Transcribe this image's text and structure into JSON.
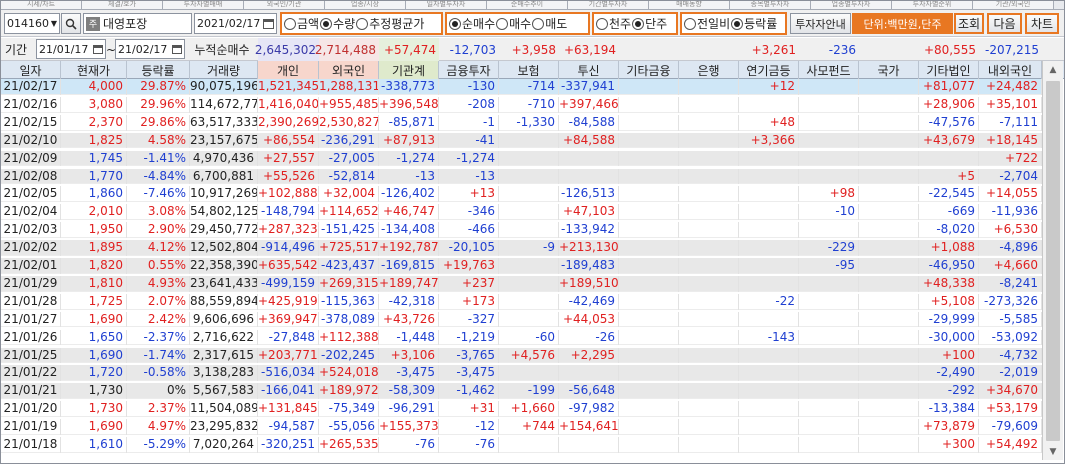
{
  "tabstrip": {
    "tabs": [
      "시세/차트",
      "체결/호가",
      "투자자별매매",
      "외국인/기관",
      "업종/시장",
      "일자별투자자",
      "순매수추이",
      "기간별투자자",
      "매매동향",
      "종목별투자자",
      "업종별투자자",
      "투자자별순위",
      "기관/외국인"
    ]
  },
  "toolbar": {
    "code": "014160",
    "name": "대영포장",
    "date": "2021/02/17",
    "group1": [
      {
        "label": "금액",
        "on": false
      },
      {
        "label": "수량",
        "on": true
      },
      {
        "label": "추정평균가",
        "on": false
      }
    ],
    "group2": [
      {
        "label": "순매수",
        "on": true
      },
      {
        "label": "매수",
        "on": false
      },
      {
        "label": "매도",
        "on": false
      }
    ],
    "group3": [
      {
        "label": "천주",
        "on": false
      },
      {
        "label": "단주",
        "on": true
      }
    ],
    "group4": [
      {
        "label": "전일비",
        "on": false
      },
      {
        "label": "등락률",
        "on": true
      }
    ],
    "guide_label": "투자자안내",
    "unit_text": "단위:백만원,단주",
    "query_label": "조회",
    "next_label": "다음",
    "chart_label": "차트"
  },
  "filter": {
    "period_label": "기간",
    "from": "21/01/17",
    "to": "21/02/17",
    "cum_label": "누적순매수",
    "values": [
      "2,645,302",
      "2,714,488",
      "+57,474",
      "-12,703",
      "+3,958",
      "+63,194",
      "",
      "",
      "+3,261",
      "-236",
      "",
      "+80,555",
      "-207,215"
    ]
  },
  "columns": [
    "일자",
    "현재가",
    "등락률",
    "거래량",
    "개인",
    "외국인",
    "기관계",
    "금융투자",
    "보험",
    "투신",
    "기타금융",
    "은행",
    "연기금등",
    "사모펀드",
    "국가",
    "기타법인",
    "내외국인"
  ],
  "colors": {
    "up": "#e02020",
    "down": "#1f3fd1",
    "selected_row": "#cfe7f7",
    "alt_row": "#e8e8e8",
    "accent": "#e87722",
    "header_personal": "#f7d6cc",
    "header_foreign": "#f7d6cc",
    "header_inst": "#dfeacc"
  },
  "rows": [
    [
      "21/02/17",
      "4,000",
      "29.87%",
      "90,075,196",
      "1,521,345",
      "1,288,131",
      "-338,773",
      "-130",
      "-714",
      "-337,941",
      "",
      "",
      "+12",
      "",
      "",
      "+81,077",
      "+24,482"
    ],
    [
      "21/02/16",
      "3,080",
      "29.96%",
      "114,672,772",
      "1,416,040",
      "+955,485",
      "+396,548",
      "-208",
      "-710",
      "+397,466",
      "",
      "",
      "",
      "",
      "",
      "+28,906",
      "+35,101"
    ],
    [
      "21/02/15",
      "2,370",
      "29.86%",
      "63,517,333",
      "2,390,269",
      "2,530,827",
      "-85,871",
      "-1",
      "-1,330",
      "-84,588",
      "",
      "",
      "+48",
      "",
      "",
      "-47,576",
      "-7,111"
    ],
    [
      "21/02/10",
      "1,825",
      "4.58%",
      "23,157,675",
      "+86,554",
      "-236,291",
      "+87,913",
      "-41",
      "",
      "+84,588",
      "",
      "",
      "+3,366",
      "",
      "",
      "+43,679",
      "+18,145"
    ],
    [
      "21/02/09",
      "1,745",
      "-1.41%",
      "4,970,436",
      "+27,557",
      "-27,005",
      "-1,274",
      "-1,274",
      "",
      "",
      "",
      "",
      "",
      "",
      "",
      "",
      "+722"
    ],
    [
      "21/02/08",
      "1,770",
      "-4.84%",
      "6,700,881",
      "+55,526",
      "-52,814",
      "-13",
      "-13",
      "",
      "",
      "",
      "",
      "",
      "",
      "",
      "+5",
      "-2,704"
    ],
    [
      "21/02/05",
      "1,860",
      "-7.46%",
      "10,917,269",
      "+102,888",
      "+32,004",
      "-126,402",
      "+13",
      "",
      "-126,513",
      "",
      "",
      "",
      "+98",
      "",
      "-22,545",
      "+14,055"
    ],
    [
      "21/02/04",
      "2,010",
      "3.08%",
      "54,802,125",
      "-148,794",
      "+114,652",
      "+46,747",
      "-346",
      "",
      "+47,103",
      "",
      "",
      "",
      "-10",
      "",
      "-669",
      "-11,936"
    ],
    [
      "21/02/03",
      "1,950",
      "2.90%",
      "29,450,772",
      "+287,323",
      "-151,425",
      "-134,408",
      "-466",
      "",
      "-133,942",
      "",
      "",
      "",
      "",
      "",
      "-8,020",
      "+6,530"
    ],
    [
      "21/02/02",
      "1,895",
      "4.12%",
      "12,502,804",
      "-914,496",
      "+725,517",
      "+192,787",
      "-20,105",
      "-9",
      "+213,130",
      "",
      "",
      "",
      "-229",
      "",
      "+1,088",
      "-4,896"
    ],
    [
      "21/02/01",
      "1,820",
      "0.55%",
      "22,358,390",
      "+635,542",
      "-423,437",
      "-169,815",
      "+19,763",
      "",
      "-189,483",
      "",
      "",
      "",
      "-95",
      "",
      "-46,950",
      "+4,660"
    ],
    [
      "21/01/29",
      "1,810",
      "4.93%",
      "23,641,433",
      "-499,159",
      "+269,315",
      "+189,747",
      "+237",
      "",
      "+189,510",
      "",
      "",
      "",
      "",
      "",
      "+48,338",
      "-8,241"
    ],
    [
      "21/01/28",
      "1,725",
      "2.07%",
      "88,559,894",
      "+425,919",
      "-115,363",
      "-42,318",
      "+173",
      "",
      "-42,469",
      "",
      "",
      "-22",
      "",
      "",
      "+5,108",
      "-273,326"
    ],
    [
      "21/01/27",
      "1,690",
      "2.42%",
      "9,606,696",
      "+369,947",
      "-378,089",
      "+43,726",
      "-327",
      "",
      "+44,053",
      "",
      "",
      "",
      "",
      "",
      "-29,999",
      "-5,585"
    ],
    [
      "21/01/26",
      "1,650",
      "-2.37%",
      "2,716,622",
      "-27,848",
      "+112,388",
      "-1,448",
      "-1,219",
      "-60",
      "-26",
      "",
      "",
      "-143",
      "",
      "",
      "-30,000",
      "-53,092"
    ],
    [
      "21/01/25",
      "1,690",
      "-1.74%",
      "2,317,615",
      "+203,771",
      "-202,245",
      "+3,106",
      "-3,765",
      "+4,576",
      "+2,295",
      "",
      "",
      "",
      "",
      "",
      "+100",
      "-4,732"
    ],
    [
      "21/01/22",
      "1,720",
      "-0.58%",
      "3,138,283",
      "-516,034",
      "+524,018",
      "-3,475",
      "-3,475",
      "",
      "",
      "",
      "",
      "",
      "",
      "",
      "-2,490",
      "-2,019"
    ],
    [
      "21/01/21",
      "1,730",
      "0%",
      "5,567,583",
      "-166,041",
      "+189,972",
      "-58,309",
      "-1,462",
      "-199",
      "-56,648",
      "",
      "",
      "",
      "",
      "",
      "-292",
      "+34,670"
    ],
    [
      "21/01/20",
      "1,730",
      "2.37%",
      "11,504,089",
      "+131,845",
      "-75,349",
      "-96,291",
      "+31",
      "+1,660",
      "-97,982",
      "",
      "",
      "",
      "",
      "",
      "-13,384",
      "+53,179"
    ],
    [
      "21/01/19",
      "1,690",
      "4.97%",
      "23,295,832",
      "-94,587",
      "-55,056",
      "+155,373",
      "-12",
      "+744",
      "+154,641",
      "",
      "",
      "",
      "",
      "",
      "+73,879",
      "-79,609"
    ],
    [
      "21/01/18",
      "1,610",
      "-5.29%",
      "7,020,264",
      "-320,251",
      "+265,535",
      "-76",
      "-76",
      "",
      "",
      "",
      "",
      "",
      "",
      "",
      "+300",
      "+54,492"
    ]
  ]
}
